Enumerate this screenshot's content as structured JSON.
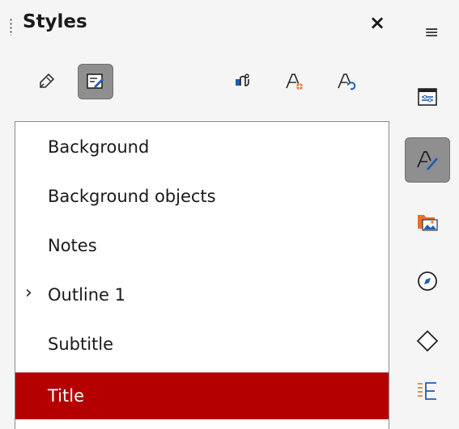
{
  "panel": {
    "title": "Styles",
    "close_glyph": "×"
  },
  "toolbar": {
    "buttons": [
      {
        "icon": "drawing-styles-icon",
        "active": false
      },
      {
        "icon": "presentation-styles-icon",
        "active": true
      },
      {
        "icon": "fill-format-mode-icon",
        "active": false
      },
      {
        "icon": "new-style-from-selection-icon",
        "active": false
      },
      {
        "icon": "update-style-icon",
        "active": false
      }
    ]
  },
  "styles_list": {
    "items": [
      {
        "label": "Background",
        "expandable": false,
        "selected": false
      },
      {
        "label": "Background objects",
        "expandable": false,
        "selected": false
      },
      {
        "label": "Notes",
        "expandable": false,
        "selected": false
      },
      {
        "label": "Outline 1",
        "expandable": true,
        "selected": false
      },
      {
        "label": "Subtitle",
        "expandable": false,
        "selected": false
      },
      {
        "label": "Title",
        "expandable": false,
        "selected": true
      }
    ],
    "expand_glyph": "›"
  },
  "sidebar": {
    "menu_glyph": "≡",
    "buttons": [
      {
        "icon": "properties-icon",
        "active": false
      },
      {
        "icon": "styles-icon",
        "active": true
      },
      {
        "icon": "gallery-icon",
        "active": false
      },
      {
        "icon": "navigator-icon",
        "active": false
      },
      {
        "icon": "shapes-icon",
        "active": false
      },
      {
        "icon": "slide-layouts-icon",
        "active": false
      }
    ]
  },
  "colors": {
    "selection": "#b40000",
    "active_button": "#8f8f8f",
    "accent_blue": "#1e5fb8",
    "accent_orange": "#e8702a"
  }
}
